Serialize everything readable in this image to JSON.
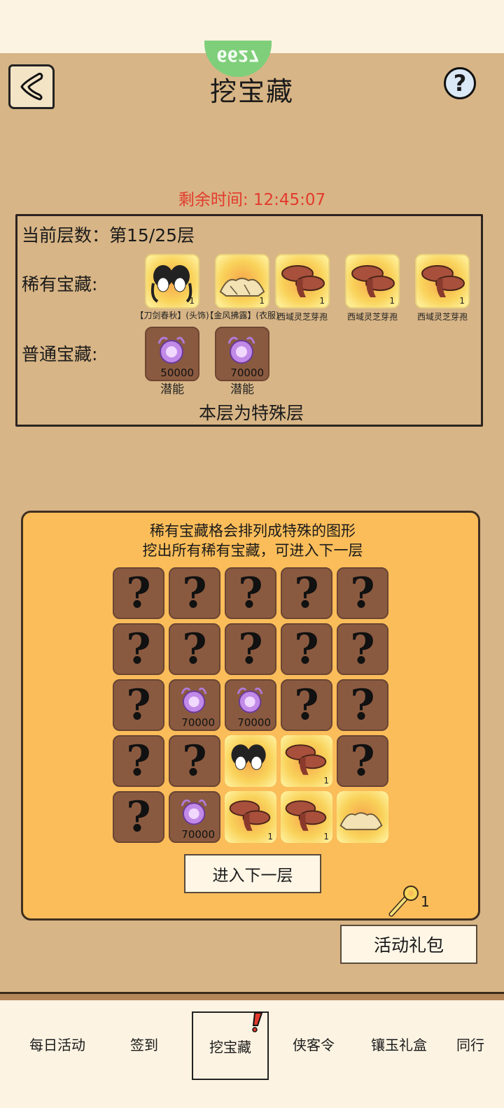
{
  "header": {
    "top_badge_text": "6627",
    "title": "挖宝藏"
  },
  "timer": {
    "text": "剩余时间: 12:45:07",
    "color": "#e23b2e"
  },
  "info": {
    "floor_text": "当前层数：第15/25层",
    "rare_label": "稀有宝藏:",
    "common_label": "普通宝藏:",
    "special_note": "本层为特殊层",
    "rare_items": [
      {
        "name": "【刀剑春秋】(头饰)",
        "qty": "1",
        "icon": "hairstyle-icon"
      },
      {
        "name": "【金风拂露】(衣服)",
        "qty": "1",
        "icon": "robe-icon"
      },
      {
        "name": "西域灵芝芽孢",
        "qty": "1",
        "icon": "lingzhi-mushroom-icon"
      },
      {
        "name": "西域灵芝芽孢",
        "qty": "1",
        "icon": "lingzhi-mushroom-icon"
      },
      {
        "name": "西域灵芝芽孢",
        "qty": "1",
        "icon": "lingzhi-mushroom-icon"
      }
    ],
    "common_items": [
      {
        "name": "潜能",
        "qty": "50000",
        "icon": "potential-orb-icon"
      },
      {
        "name": "潜能",
        "qty": "70000",
        "icon": "potential-orb-icon"
      }
    ]
  },
  "panel": {
    "line1": "稀有宝藏格会排列成特殊的图形",
    "line2": "挖出所有稀有宝藏，可进入下一层",
    "next_button": "进入下一层",
    "key_count": "1",
    "grid": [
      [
        "?",
        "?",
        "?",
        "?",
        "?"
      ],
      [
        "?",
        "?",
        "?",
        "?",
        "?"
      ],
      [
        "?",
        "orb:70000",
        "orb:70000",
        "?",
        "?"
      ],
      [
        "?",
        "?",
        "hair",
        "mushroom:1",
        "?"
      ],
      [
        "?",
        "orb:70000",
        "mushroom:1",
        "mushroom:1",
        "robe"
      ]
    ],
    "unknown_symbol": "?"
  },
  "gift_button": "活动礼包",
  "bottom_nav": {
    "tabs": [
      "每日活动",
      "签到",
      "挖宝藏",
      "侠客令",
      "镶玉礼盒",
      "同行"
    ],
    "active_index": 2
  },
  "colors": {
    "panel_bg": "#fabd5a",
    "page_bg": "#d8b586",
    "unknown_tile": "#8a5a40"
  }
}
